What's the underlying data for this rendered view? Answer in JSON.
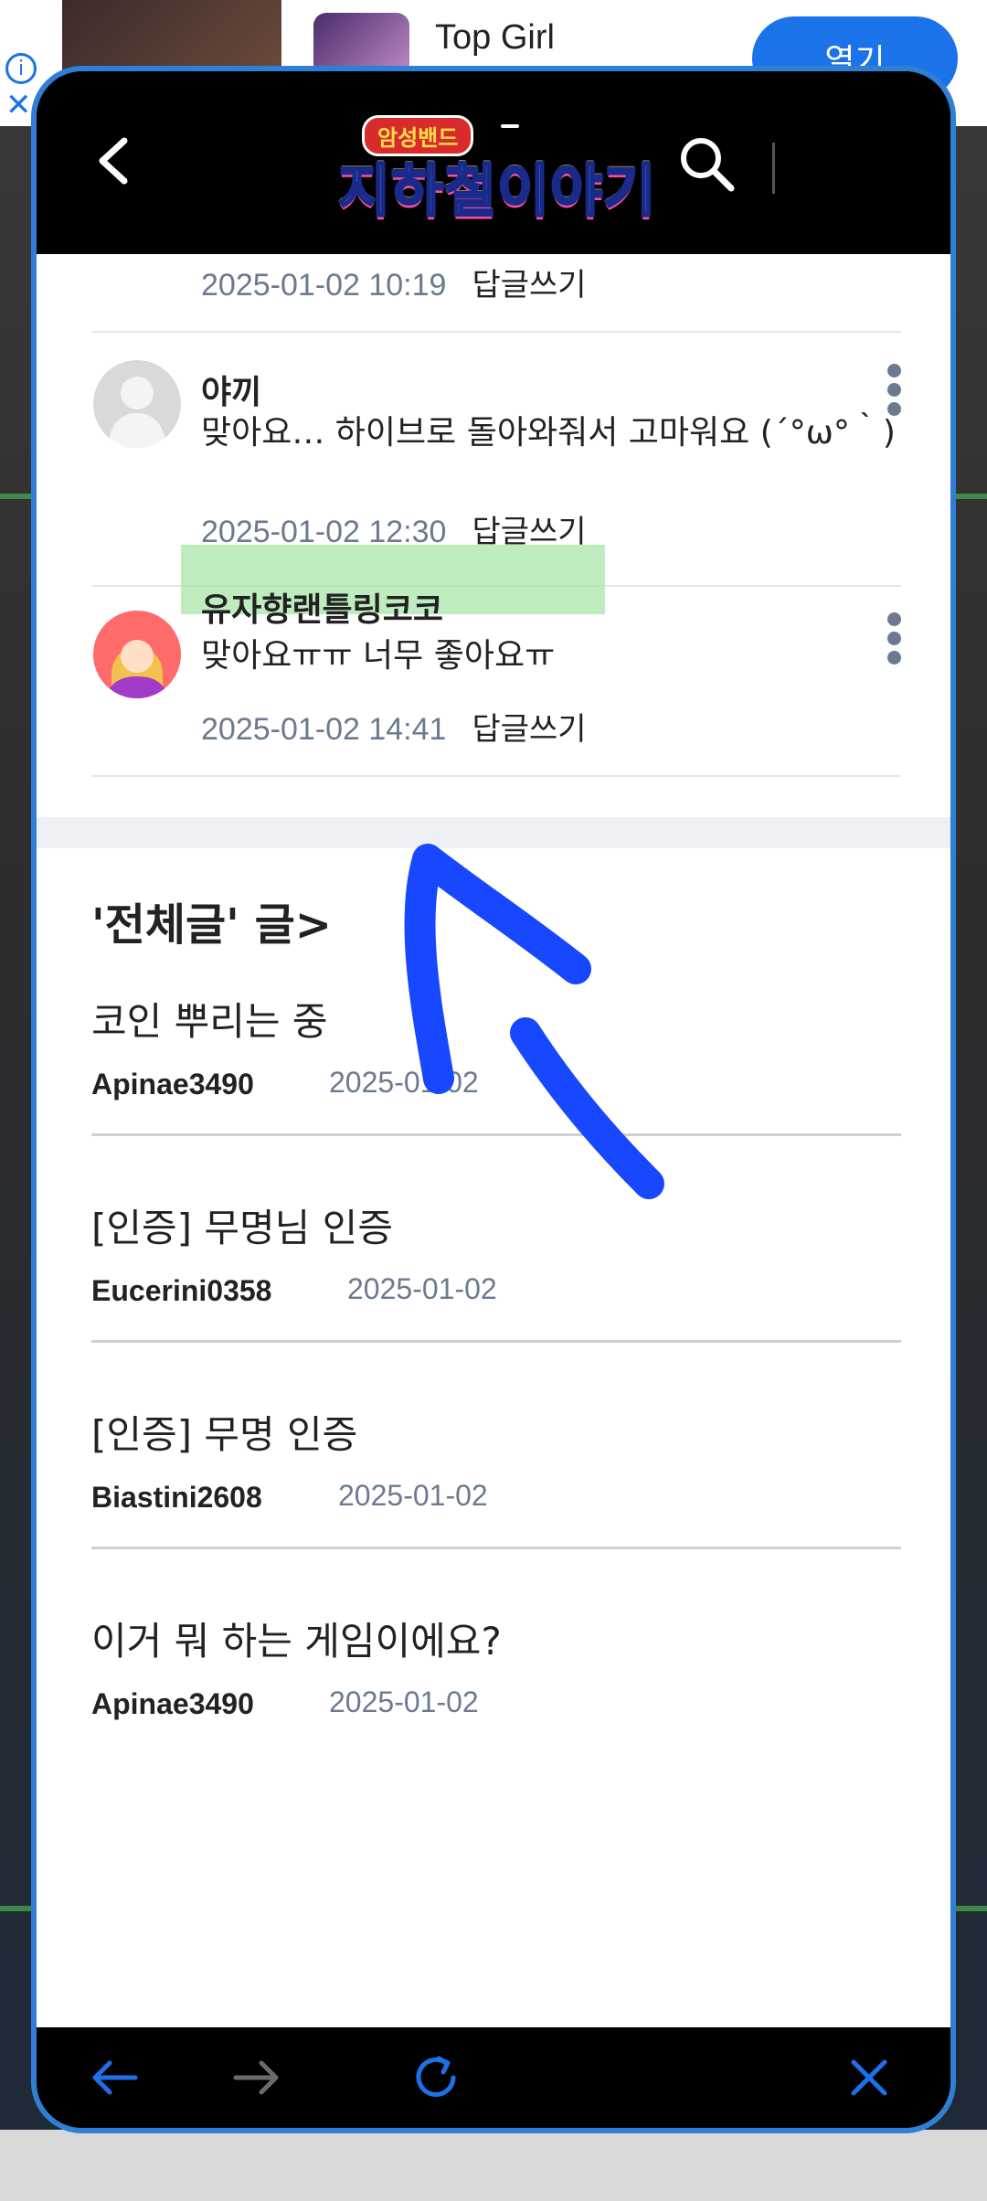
{
  "background_ad": {
    "title": "Top Girl",
    "open_label": "열기",
    "info_icon": "info-icon",
    "close_icon": "close-icon"
  },
  "topbar": {
    "back_icon": "back-arrow-icon",
    "logo_badge": "암성밴드",
    "logo_title": "지하철이야기",
    "search_icon": "search-icon"
  },
  "comments": [
    {
      "date": "2025-01-02 10:19",
      "reply_label": "답글쓰기"
    },
    {
      "author": "야끼",
      "body": "맞아요… 하이브로 돌아와줘서 고마워요 (´°ω°｀)",
      "date": "2025-01-02 12:30",
      "reply_label": "답글쓰기",
      "avatar": "default-avatar"
    },
    {
      "author": "유자향랜틀링코코",
      "body": "맞아요ㅠㅠ 너무 좋아요ㅠ",
      "date": "2025-01-02 14:41",
      "reply_label": "답글쓰기",
      "avatar": "girl-avatar",
      "highlighted": true
    }
  ],
  "section": {
    "title": "'전체글' 글>"
  },
  "posts": [
    {
      "title": "코인 뿌리는 중",
      "author": "Apinae3490",
      "date": "2025-01-02"
    },
    {
      "title": "[인증] 무명님 인증",
      "author": "Eucerini0358",
      "date": "2025-01-02"
    },
    {
      "title": "[인증] 무명 인증",
      "author": "Biastini2608",
      "date": "2025-01-02"
    },
    {
      "title": "이거 뭐 하는 게임이에요?",
      "author": "Apinae3490",
      "date": "2025-01-02"
    }
  ],
  "navbar": {
    "back": "back-arrow-icon",
    "forward": "forward-arrow-icon",
    "refresh": "refresh-icon",
    "close": "close-icon"
  },
  "colors": {
    "dialog_border": "#2f7fd6",
    "nav_icon": "#1f6fe8",
    "annotation_arrow": "#1747ff",
    "highlight": "#a8e6a8"
  }
}
